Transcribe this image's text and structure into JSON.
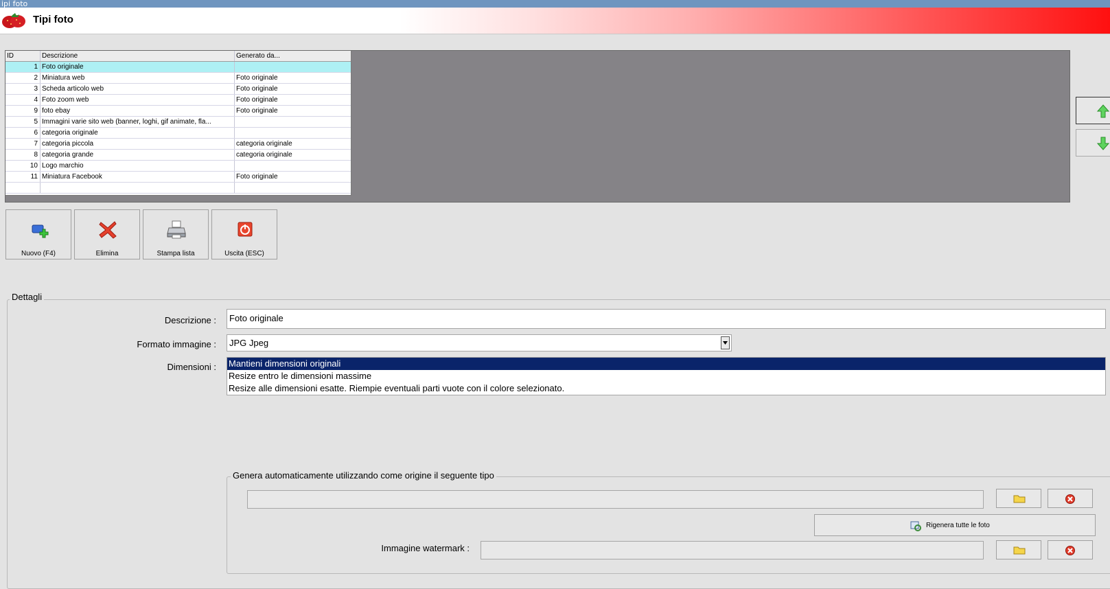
{
  "window": {
    "title": "ipi foto"
  },
  "header": {
    "title": "Tipi foto",
    "logo_icon": "strawberry-icon"
  },
  "grid": {
    "columns": [
      "ID",
      "Descrizione",
      "Generato da..."
    ],
    "rows": [
      {
        "id": "1",
        "desc": "Foto originale",
        "gen": ""
      },
      {
        "id": "2",
        "desc": "Miniatura web",
        "gen": "Foto originale"
      },
      {
        "id": "3",
        "desc": "Scheda articolo web",
        "gen": "Foto originale"
      },
      {
        "id": "4",
        "desc": "Foto zoom web",
        "gen": "Foto originale"
      },
      {
        "id": "9",
        "desc": "foto ebay",
        "gen": "Foto originale"
      },
      {
        "id": "5",
        "desc": "Immagini varie sito web (banner, loghi, gif animate, fla...",
        "gen": ""
      },
      {
        "id": "6",
        "desc": "categoria originale",
        "gen": ""
      },
      {
        "id": "7",
        "desc": "categoria piccola",
        "gen": "categoria originale"
      },
      {
        "id": "8",
        "desc": "categoria grande",
        "gen": "categoria originale"
      },
      {
        "id": "10",
        "desc": "Logo marchio",
        "gen": ""
      },
      {
        "id": "11",
        "desc": "Miniatura Facebook",
        "gen": "Foto originale"
      },
      {
        "id": "",
        "desc": "",
        "gen": ""
      }
    ],
    "selected_row": 0
  },
  "nav": {
    "up_icon": "arrow-up-icon",
    "down_icon": "arrow-down-icon"
  },
  "toolbar": {
    "new_label": "Nuovo (F4)",
    "delete_label": "Elimina",
    "print_label": "Stampa lista",
    "exit_label": "Uscita (ESC)"
  },
  "details": {
    "group_title": "Dettagli",
    "descrizione_label": "Descrizione :",
    "descrizione_value": "Foto originale",
    "formato_label": "Formato immagine :",
    "formato_value": "JPG Jpeg",
    "dimensioni_label": "Dimensioni :",
    "dimensioni_options": [
      "Mantieni dimensioni originali",
      "Resize entro le dimensioni massime",
      "Resize alle dimensioni esatte. Riempie eventuali parti vuote con il colore selezionato."
    ],
    "dimensioni_selected": 0
  },
  "auto": {
    "group_title": "Genera automaticamente utilizzando come origine il seguente tipo",
    "origin_value": "",
    "regen_label": "Rigenera tutte le foto",
    "watermark_label": "Immagine watermark :",
    "watermark_value": ""
  },
  "colors": {
    "selected_row": "#aef0f4",
    "list_selection": "#0a246a",
    "header_gradient_end": "#ff1010"
  }
}
